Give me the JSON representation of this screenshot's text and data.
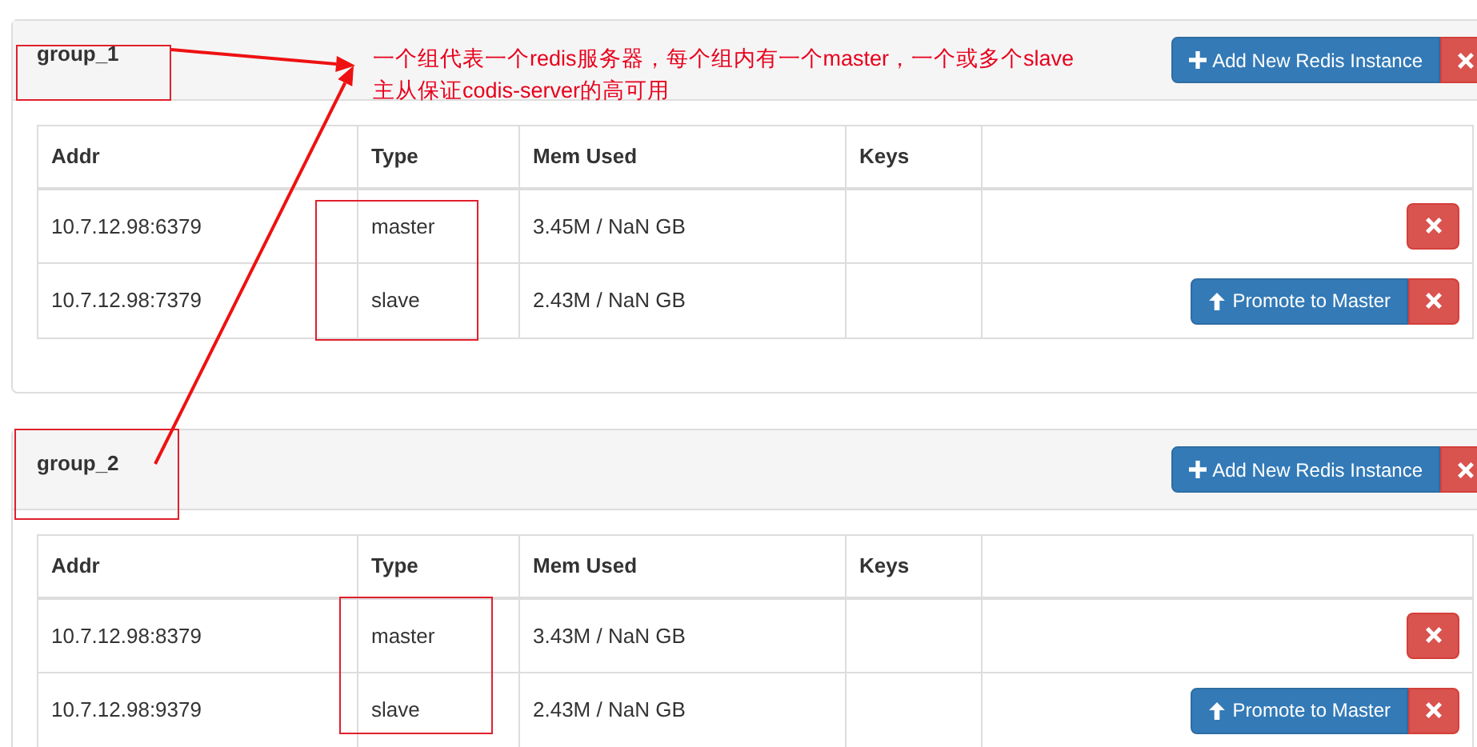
{
  "groups": [
    {
      "name": "group_1",
      "add_button": "Add New Redis Instance",
      "columns": [
        "Addr",
        "Type",
        "Mem Used",
        "Keys"
      ],
      "servers": [
        {
          "addr": "10.7.12.98:6379",
          "type": "master",
          "mem_used": "3.45M / NaN GB",
          "kind": "master"
        },
        {
          "addr": "10.7.12.98:7379",
          "type": "slave",
          "mem_used": "2.43M / NaN GB",
          "kind": "slave",
          "promote_button": "Promote to Master"
        }
      ]
    },
    {
      "name": "group_2",
      "add_button": "Add New Redis Instance",
      "columns": [
        "Addr",
        "Type",
        "Mem Used",
        "Keys"
      ],
      "servers": [
        {
          "addr": "10.7.12.98:8379",
          "type": "master",
          "mem_used": "3.43M / NaN GB",
          "kind": "master"
        },
        {
          "addr": "10.7.12.98:9379",
          "type": "slave",
          "mem_used": "2.43M / NaN GB",
          "kind": "slave",
          "promote_button": "Promote to Master"
        }
      ]
    }
  ],
  "annotation": {
    "lines": [
      "一个组代表一个redis服务器，每个组内有一个master，一个或多个slave",
      "主从保证codis-server的高可用"
    ]
  }
}
